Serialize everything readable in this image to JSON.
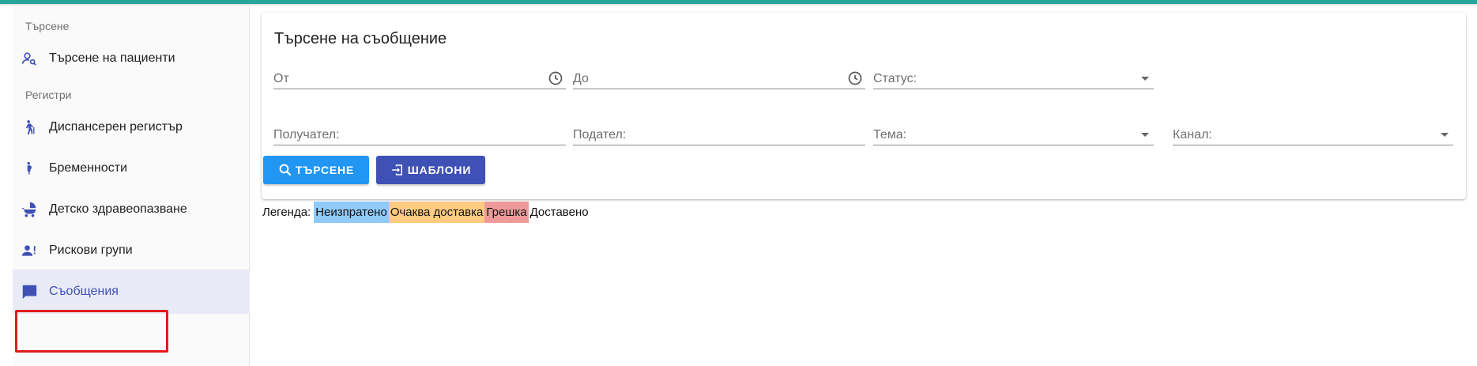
{
  "colors": {
    "top_bar": "#26a69a",
    "accent": "#3f51b5",
    "search_button": "#2196f3",
    "templates_button": "#3f51b5",
    "legend_not_sent": "#90caf9",
    "legend_pending": "#ffcc80",
    "legend_error": "#ef9a9a"
  },
  "sidebar": {
    "section_search": "Търсене",
    "item_patients": {
      "label": "Търсене на пациенти",
      "icon": "person-search-icon"
    },
    "section_registers": "Регистри",
    "items": [
      {
        "label": "Диспансерен регистър",
        "icon": "elderly-walking-icon"
      },
      {
        "label": "Бременности",
        "icon": "pregnant-woman-icon"
      },
      {
        "label": "Детско здравеопазване",
        "icon": "baby-carriage-icon"
      },
      {
        "label": "Рискови групи",
        "icon": "person-alert-icon"
      },
      {
        "label": "Съобщения",
        "icon": "message-icon",
        "active": true
      }
    ]
  },
  "main": {
    "title": "Търсене на съобщение",
    "fields": {
      "from": {
        "placeholder": "От",
        "icon": "clock-icon"
      },
      "to": {
        "placeholder": "До",
        "icon": "clock-icon"
      },
      "status": {
        "placeholder": "Статус:"
      },
      "recipient": {
        "placeholder": "Получател:"
      },
      "sender": {
        "placeholder": "Подател:"
      },
      "subject": {
        "placeholder": "Тема:"
      },
      "channel": {
        "placeholder": "Канал:"
      }
    },
    "buttons": {
      "search": {
        "label": "ТЪРСЕНЕ",
        "icon": "search-icon"
      },
      "templates": {
        "label": "ШАБЛОНИ",
        "icon": "login-icon"
      }
    }
  },
  "legend": {
    "title": "Легенда:",
    "items": [
      "Неизпратено",
      "Очаква доставка",
      "Грешка",
      "Доставено"
    ]
  }
}
